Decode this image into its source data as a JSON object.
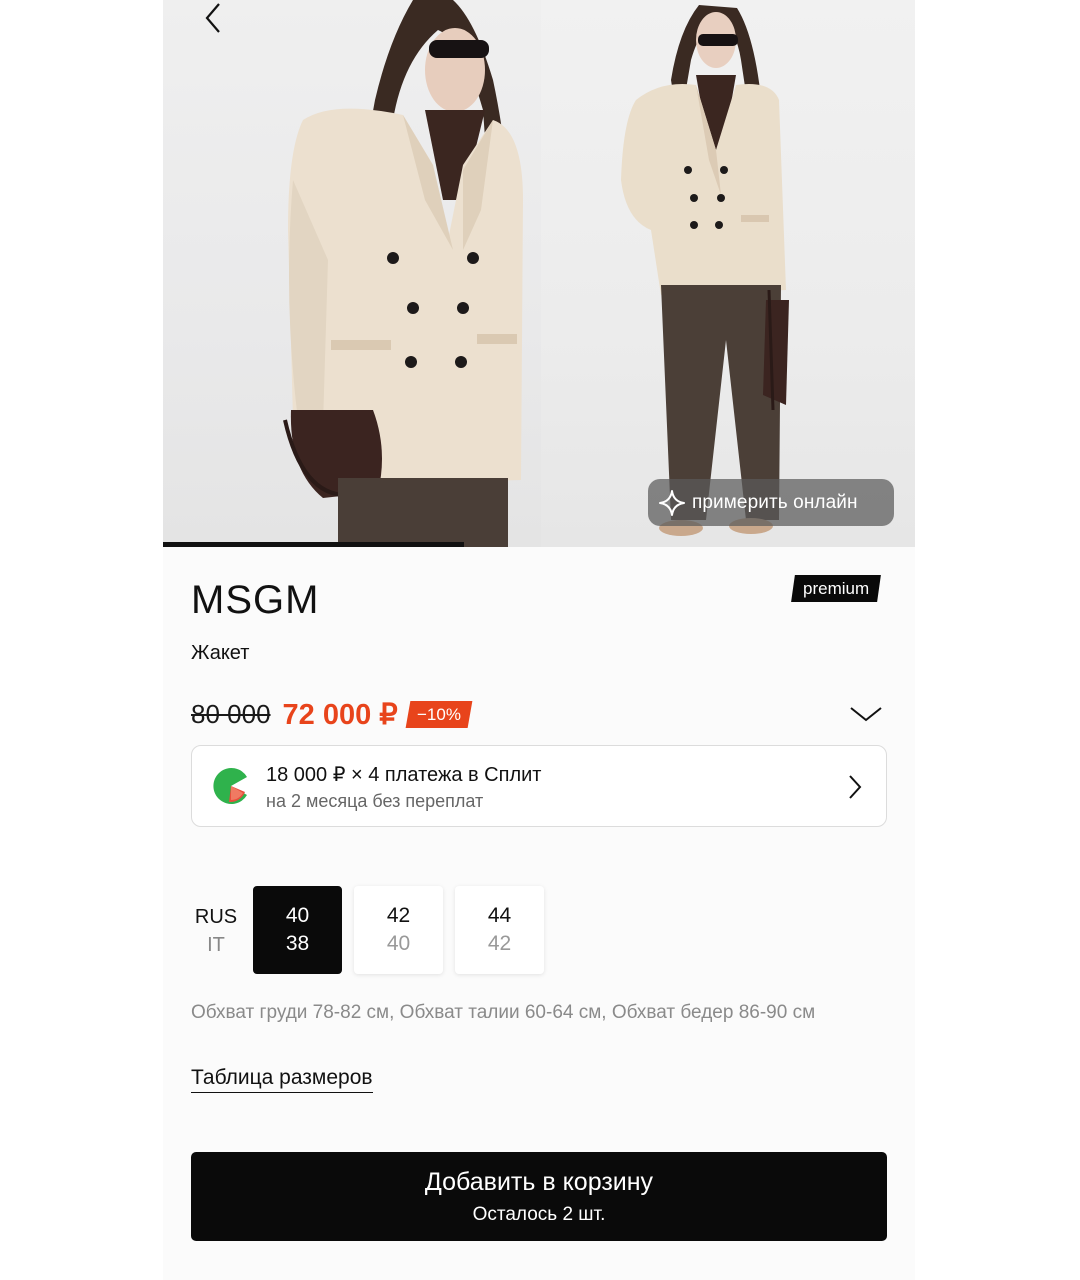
{
  "gallery": {
    "progress_fraction": 0.4,
    "try_on_label": "примерить онлайн"
  },
  "product": {
    "badge": "premium",
    "brand": "MSGM",
    "type": "Жакет",
    "old_price": "80 000",
    "new_price": "72 000 ₽",
    "discount": "−10%"
  },
  "split": {
    "title": "18 000 ₽ × 4 платежа в Сплит",
    "subtitle": "на 2 месяца без переплат"
  },
  "sizes": {
    "label_primary": "RUS",
    "label_secondary": "IT",
    "options": [
      {
        "rus": "40",
        "it": "38",
        "selected": true
      },
      {
        "rus": "42",
        "it": "40",
        "selected": false
      },
      {
        "rus": "44",
        "it": "42",
        "selected": false
      }
    ],
    "measurements": "Обхват груди 78-82 см, Обхват талии 60-64 см, Обхват бедер 86-90 см",
    "size_table_link": "Таблица размеров"
  },
  "cart": {
    "label": "Добавить в корзину",
    "stock": "Осталось 2 шт."
  },
  "colors": {
    "accent": "#e8441b",
    "dark": "#0a0a0a"
  }
}
